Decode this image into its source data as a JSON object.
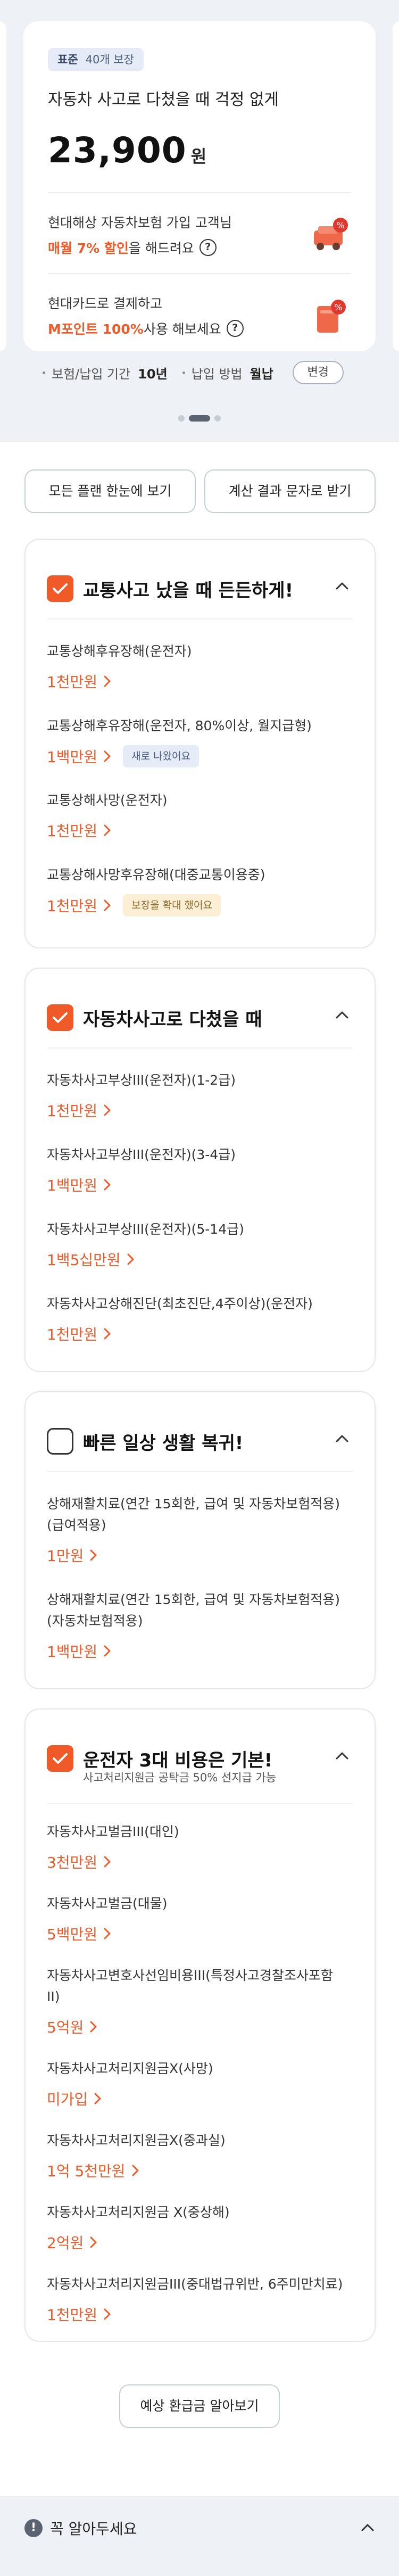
{
  "plan": {
    "tag_type": "표준",
    "tag_count": "40개 보장",
    "title": "자동차 사고로 다쳤을 때 걱정 없게",
    "price": "23,900",
    "currency": "원",
    "benefit1_line1": "현대해상 자동차보험 가입 고객님",
    "benefit1_highlight": "매월 7% 할인",
    "benefit1_suffix": "을 해드려요",
    "benefit2_line1": "현대카드로 결제하고",
    "benefit2_highlight": "M포인트 100%",
    "benefit2_suffix": " 사용 해보세요",
    "question_mark": "?",
    "period_label": "보험/납입 기간",
    "period_value": "10년",
    "method_label": "납입 방법",
    "method_value": "월납",
    "change_label": "변경",
    "pager_active_index": 1,
    "pager_count": 3
  },
  "actions": {
    "compare_all": "모든 플랜 한눈에 보기",
    "send_sms": "계산 결과 문자로 받기",
    "refund": "예상 환급금 알아보기"
  },
  "sections": [
    {
      "title": "교통사고 났을 때 든든하게!",
      "checked": true,
      "items": [
        {
          "name": "교통상해후유장해(운전자)",
          "value": "1천만원"
        },
        {
          "name": "교통상해후유장해(운전자, 80%이상, 월지급형)",
          "value": "1백만원",
          "badge": "새로 나왔어요"
        },
        {
          "name": "교통상해사망(운전자)",
          "value": "1천만원"
        },
        {
          "name": "교통상해사망후유장해(대중교통이용중)",
          "value": "1천만원",
          "badge": "보장을 확대 했어요"
        }
      ]
    },
    {
      "title": "자동차사고로 다쳤을 때",
      "checked": true,
      "items": [
        {
          "name": "자동차사고부상III(운전자)(1-2급)",
          "value": "1천만원"
        },
        {
          "name": "자동차사고부상III(운전자)(3-4급)",
          "value": "1백만원"
        },
        {
          "name": "자동차사고부상III(운전자)(5-14급)",
          "value": "1백5십만원"
        },
        {
          "name": "자동차사고상해진단(최초진단,4주이상)(운전자)",
          "value": "1천만원"
        }
      ]
    },
    {
      "title": "빠른 일상 생활 복귀!",
      "checked": false,
      "items": [
        {
          "name_line1": "상해재활치료(연간 15회한, 급여 및 자동차보험적용)",
          "name_line2": "(급여적용)",
          "value": "1만원"
        },
        {
          "name_line1": "상해재활치료(연간 15회한, 급여 및 자동차보험적용)",
          "name_line2": "(자동차보험적용)",
          "value": "1백만원"
        }
      ]
    },
    {
      "title": "운전자 3대 비용은 기본!",
      "subtitle": "사고처리지원금 공탁금 50% 선지급 가능",
      "checked": true,
      "items": [
        {
          "name": "자동차사고벌금III(대인)",
          "value": "3천만원"
        },
        {
          "name": "자동차사고벌금(대물)",
          "value": "5백만원"
        },
        {
          "name_line1": "자동차사고변호사선임비용III(특정사고경찰조사포함",
          "name_line2": "II)",
          "value": "5억원"
        },
        {
          "name": "자동차사고처리지원금X(사망)",
          "value": "미가입"
        },
        {
          "name": "자동차사고처리지원금X(중과실)",
          "value": "1억 5천만원"
        },
        {
          "name": "자동차사고처리지원금 X(중상해)",
          "value": "2억원"
        },
        {
          "name": "자동차사고처리지원금III(중대법규위반, 6주미만치료)",
          "value": "1천만원"
        }
      ]
    }
  ],
  "notice": {
    "title": "꼭 알아두세요",
    "icon_text": "!"
  },
  "colors": {
    "accent": "#f05a28",
    "background": "#eef1f5",
    "badge_blue": "#e6ecf7",
    "badge_yellow": "#fcefd6"
  },
  "icons": [
    "question-circle-icon",
    "car-discount-icon",
    "card-point-icon",
    "checkbox-icon",
    "chevron-up-icon",
    "chevron-right-icon",
    "alert-icon"
  ]
}
